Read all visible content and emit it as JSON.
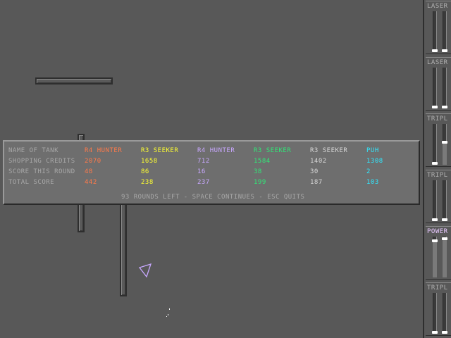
{
  "scoreboard": {
    "row_labels": [
      "NAME OF TANK",
      "SHOPPING CREDITS",
      "SCORE THIS ROUND",
      "TOTAL SCORE"
    ],
    "players": [
      {
        "name": "R4 HUNTER",
        "credits": "2070",
        "round": "48",
        "total": "442",
        "color": "#ff7a4a"
      },
      {
        "name": "R3 SEEKER",
        "credits": "1658",
        "round": "86",
        "total": "238",
        "color": "#ffff30"
      },
      {
        "name": "R4 HUNTER",
        "credits": "712",
        "round": "16",
        "total": "237",
        "color": "#c8a8ff"
      },
      {
        "name": "R3 SEEKER",
        "credits": "1584",
        "round": "38",
        "total": "199",
        "color": "#30e878"
      },
      {
        "name": "R3 SEEKER",
        "credits": "1402",
        "round": "30",
        "total": "187",
        "color": "#d8d8d8"
      },
      {
        "name": "PUH",
        "credits": "1308",
        "round": "2",
        "total": "103",
        "color": "#30e8ff"
      }
    ],
    "footer": "93 ROUNDS LEFT - SPACE CONTINUES - ESC QUITS"
  },
  "sidebar": {
    "weapons": [
      {
        "label": "LASER",
        "active": false,
        "levels": [
          0.0,
          0.0
        ]
      },
      {
        "label": "LASER",
        "active": false,
        "levels": [
          0.0,
          0.0
        ]
      },
      {
        "label": "TRIPL",
        "active": false,
        "levels": [
          0.0,
          0.55
        ]
      },
      {
        "label": "TRIPL",
        "active": false,
        "levels": [
          0.0,
          0.0
        ]
      },
      {
        "label": "POWER",
        "active": true,
        "levels": [
          0.9,
          0.95
        ]
      },
      {
        "label": "TRIPL",
        "active": false,
        "levels": [
          0.0,
          0.0
        ]
      }
    ]
  },
  "colors": {
    "background": "#585858",
    "panel": "#6e6e6e",
    "tank_outline": "#c8a8ff"
  },
  "icons": {
    "tank": "triangle-outline-icon"
  }
}
